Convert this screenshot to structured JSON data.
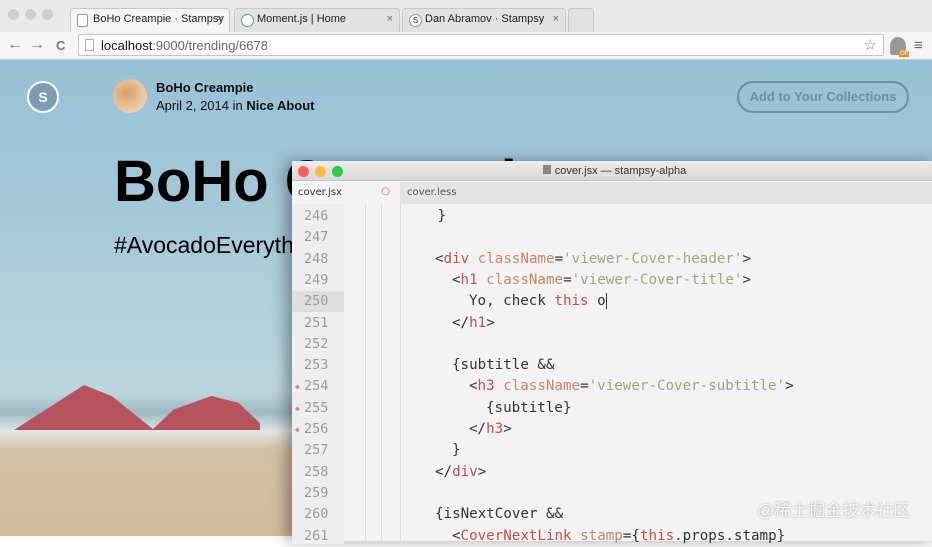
{
  "browser": {
    "tabs": [
      {
        "label": "BoHo Creampie · Stampsy",
        "active": true
      },
      {
        "label": "Moment.js | Home",
        "active": false
      },
      {
        "label": "Dan Abramov · Stampsy",
        "active": false
      }
    ],
    "tab_close": "×",
    "url_host": "localhost",
    "url_path": ":9000/trending/6678",
    "icons": [
      "back-icon",
      "forward-icon",
      "reload-icon",
      "star-icon",
      "extension-icon",
      "menu-icon"
    ],
    "ext_badge": "Off",
    "back": "←",
    "forward": "→",
    "reload": "C",
    "star": "☆",
    "menu": "≡",
    "favicon_s": "S"
  },
  "page": {
    "logo_letter": "S",
    "author": "BoHo Creampie",
    "date": "April 2, 2014",
    "in_word": "in",
    "collection": "Nice About",
    "add_button": "Add to Your Collections",
    "title": "BoHo Creampie",
    "subtitle": "#AvocadoEverything"
  },
  "editor": {
    "window_title": "cover.jsx — stampsy-alpha",
    "tabs": [
      {
        "label": "cover.jsx",
        "modified_marker": "○"
      },
      {
        "label": "cover.less"
      }
    ],
    "current_line": 250,
    "lines": [
      {
        "n": "246",
        "indent": 0.15,
        "tokens": [
          [
            "}",
            ""
          ]
        ]
      },
      {
        "n": "247",
        "indent": 0,
        "tokens": []
      },
      {
        "n": "248",
        "indent": 0,
        "tokens": [
          [
            "<",
            ""
          ],
          [
            "div",
            "tag"
          ],
          [
            " ",
            ""
          ],
          [
            "className",
            "attr"
          ],
          [
            "=",
            ""
          ],
          [
            "'viewer-Cover-header'",
            "str"
          ],
          [
            ">",
            ""
          ]
        ]
      },
      {
        "n": "249",
        "indent": 1,
        "tokens": [
          [
            "<",
            ""
          ],
          [
            "h1",
            "tag"
          ],
          [
            " ",
            ""
          ],
          [
            "className",
            "attr"
          ],
          [
            "=",
            ""
          ],
          [
            "'viewer-Cover-title'",
            "str"
          ],
          [
            ">",
            ""
          ]
        ]
      },
      {
        "n": "250",
        "indent": 2,
        "tokens": [
          [
            "Yo, check ",
            ""
          ],
          [
            "this",
            "kw"
          ],
          [
            " o",
            ""
          ]
        ],
        "cursor": true
      },
      {
        "n": "251",
        "indent": 1,
        "tokens": [
          [
            "</",
            ""
          ],
          [
            "h1",
            "tag"
          ],
          [
            ">",
            ""
          ]
        ]
      },
      {
        "n": "252",
        "indent": 0,
        "tokens": []
      },
      {
        "n": "253",
        "indent": 1,
        "tokens": [
          [
            "{subtitle &&",
            ""
          ]
        ]
      },
      {
        "n": "254",
        "indent": 2,
        "marker": true,
        "tokens": [
          [
            "<",
            ""
          ],
          [
            "h3",
            "tag"
          ],
          [
            " ",
            ""
          ],
          [
            "className",
            "attr"
          ],
          [
            "=",
            ""
          ],
          [
            "'viewer-Cover-subtitle'",
            "str"
          ],
          [
            ">",
            ""
          ]
        ]
      },
      {
        "n": "255",
        "indent": 3,
        "marker": true,
        "tokens": [
          [
            "{subtitle}",
            ""
          ]
        ]
      },
      {
        "n": "256",
        "indent": 2,
        "marker": true,
        "tokens": [
          [
            "</",
            ""
          ],
          [
            "h3",
            "tag"
          ],
          [
            ">",
            ""
          ]
        ]
      },
      {
        "n": "257",
        "indent": 1,
        "tokens": [
          [
            "}",
            ""
          ]
        ]
      },
      {
        "n": "258",
        "indent": 0,
        "tokens": [
          [
            "</",
            ""
          ],
          [
            "div",
            "tag"
          ],
          [
            ">",
            ""
          ]
        ]
      },
      {
        "n": "259",
        "indent": 0,
        "tokens": []
      },
      {
        "n": "260",
        "indent": 0,
        "tokens": [
          [
            "{isNextCover &&",
            ""
          ]
        ]
      },
      {
        "n": "261",
        "indent": 1,
        "tokens": [
          [
            "<",
            ""
          ],
          [
            "CoverNextLink",
            "tag"
          ],
          [
            " ",
            ""
          ],
          [
            "stamp",
            "attr"
          ],
          [
            "={",
            ""
          ],
          [
            "this",
            "kw"
          ],
          [
            ".props.stamp}",
            ""
          ]
        ]
      }
    ]
  },
  "watermark": "@稀土掘金技术社区",
  "colors": {
    "tag": "#c0504d",
    "attr": "#c98565",
    "string": "#9ea875",
    "page_sky": "#98c0d6",
    "button": "#6d8ea3"
  }
}
